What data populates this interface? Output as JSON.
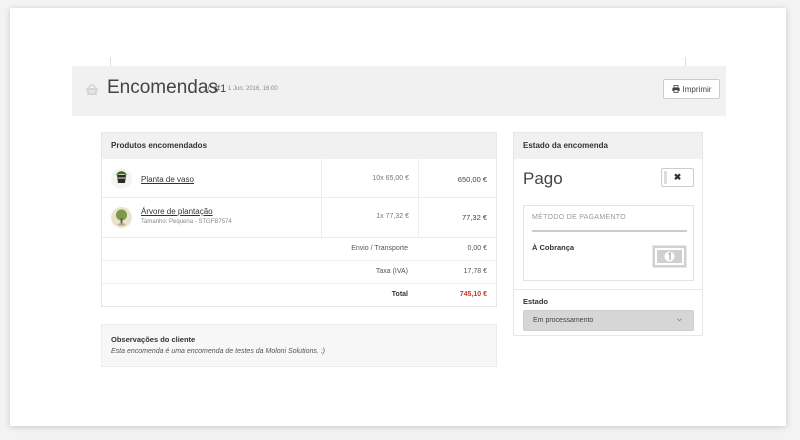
{
  "header": {
    "title": "Encomendas",
    "separator": "/",
    "order_number": "#1",
    "order_date": "1 Jun. 2016, 16:00",
    "print_label": "Imprimir"
  },
  "products": {
    "heading": "Produtos encomendados",
    "items": [
      {
        "name": "Planta de vaso",
        "subtitle": "",
        "quantity": "10x",
        "unit_price": "65,00 €",
        "total": "650,00 €",
        "icon": "potted-plant"
      },
      {
        "name": "Árvore de plantação",
        "subtitle": "Tamanho: Pequena - STGFB7574",
        "quantity": "1x",
        "unit_price": "77,32 €",
        "total": "77,32 €",
        "icon": "tree"
      }
    ],
    "summary": [
      {
        "label": "Envio / Transporte",
        "value": "0,00 €"
      },
      {
        "label": "Taxa (IVA)",
        "value": "17,78 €"
      },
      {
        "label": "Total",
        "value": "745,10 €"
      }
    ]
  },
  "notes": {
    "title": "Observações do cliente",
    "text": "Esta encomenda é uma encomenda de testes da Moloni Solutions. :)"
  },
  "status": {
    "heading": "Estado da encomenda",
    "value": "Pago",
    "toggle_symbol": "✖",
    "payment_heading": "MÉTODO DE PAGAMENTO",
    "payment_method": "À Cobrança",
    "state_label": "Estado",
    "state_selected": "Em processamento"
  },
  "colors": {
    "total_accent": "#c0392b",
    "panel_header": "#f1f1f1"
  }
}
